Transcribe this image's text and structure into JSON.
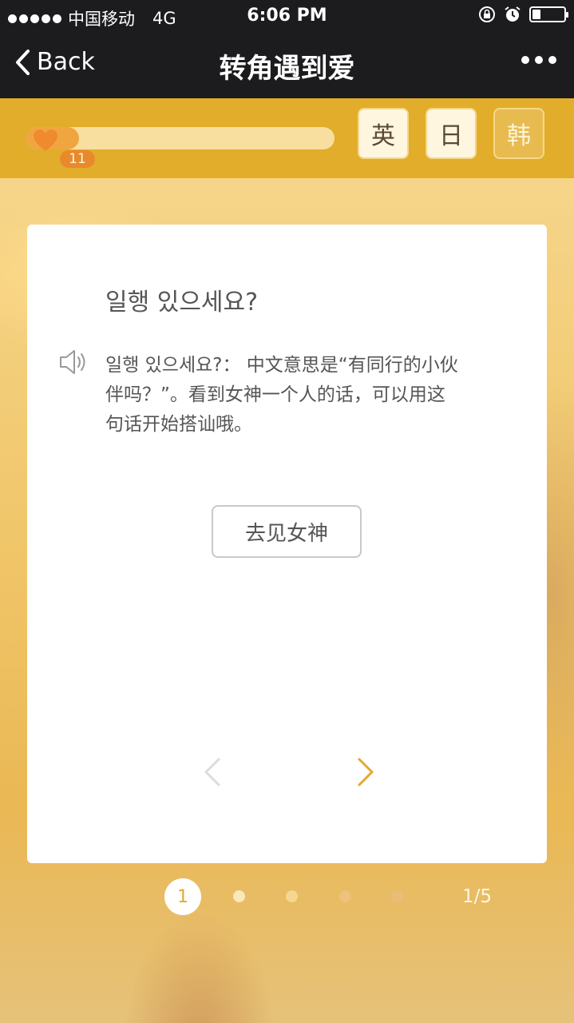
{
  "status_bar": {
    "carrier": "中国移动",
    "network": "4G",
    "time": "6:06 PM",
    "battery_level": 0.25,
    "icons": [
      "signal-dots-icon",
      "orientation-lock-icon",
      "alarm-icon",
      "battery-icon"
    ]
  },
  "nav": {
    "back_label": "Back",
    "title": "转角遇到爱",
    "icons": [
      "chevron-left-icon",
      "more-icon"
    ]
  },
  "progress": {
    "level": "11",
    "fill_fraction": 0.17,
    "icons": [
      "heart-icon"
    ]
  },
  "languages": [
    {
      "label": "英",
      "active": true
    },
    {
      "label": "日",
      "active": true
    },
    {
      "label": "韩",
      "active": false
    }
  ],
  "card": {
    "phrase": "일행 있으세요?",
    "description_lines": [
      "일행 있으세요?： 中文意思是“有同行的小伙",
      "伴吗？”。看到女神一个人的话，可以用这",
      "句话开始搭讪哦。"
    ],
    "action_label": "去见女神",
    "icons": [
      "speaker-icon",
      "chevron-left-icon",
      "chevron-right-icon"
    ]
  },
  "pager": {
    "current": "1",
    "count_text": "1/5",
    "total": 5
  },
  "colors": {
    "accent": "#e3a92c",
    "nav_background": "#1c1c1e",
    "progress_fill": "#f0a640"
  }
}
